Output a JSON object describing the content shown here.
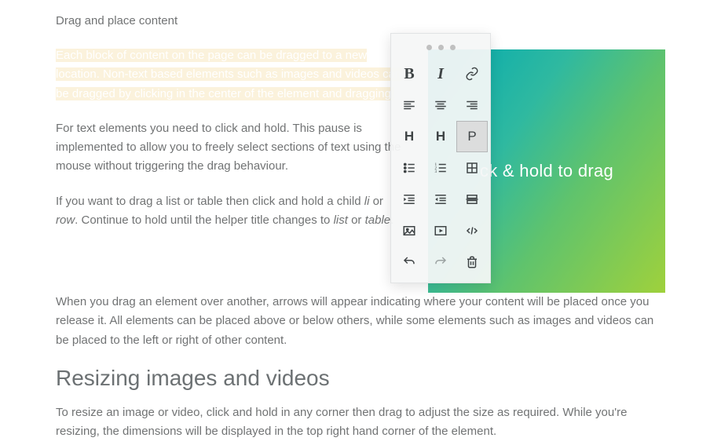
{
  "intro": "Drag and place content",
  "paragraph1": {
    "selected": "Each block of content on the page can be dragged to a new location. Non-text based elements such as images and videos can be dragged by clicking in the center of the element and dragging."
  },
  "paragraph2": "For text elements you need to click and hold. This pause is implemented to allow you to freely select sections of text using the mouse without triggering the drag behaviour.",
  "paragraph3": {
    "a": "If you want to drag a list or table then click and hold a child ",
    "li": "li",
    "b": " or ",
    "row": "row",
    "c": ". Continue to hold until the helper title changes to ",
    "list": "list",
    "d": " or ",
    "table": "table",
    "e": "."
  },
  "paragraph4": "When you drag an element over another, arrows will appear indicating where your content will be placed once you release it. All elements can be placed above or below others, while some elements such as images and videos can be placed to the left or right of other content.",
  "section_heading": "Resizing images and videos",
  "paragraph5": "To resize an image or video, click and hold in any corner then drag to adjust the size as required. While you're resizing, the dimensions will be displayed in the top right hand corner of the element.",
  "image_caption_suffix": "ck & hold to drag",
  "tool_labels": {
    "B": "B",
    "I": "I",
    "H1": "H",
    "H2": "H",
    "P": "P"
  }
}
